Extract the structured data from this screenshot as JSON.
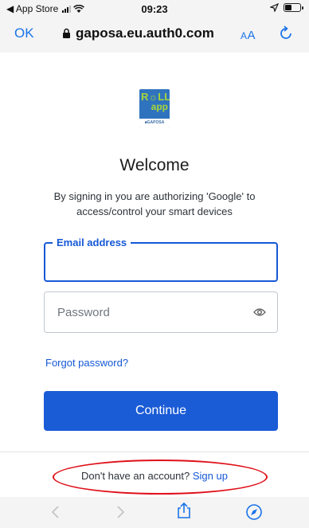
{
  "status_bar": {
    "carrier": "◀ App Store",
    "time": "09:23",
    "battery_level": 0.45
  },
  "address_bar": {
    "done_label": "OK",
    "url": "gaposa.eu.auth0.com",
    "text_size_label_small": "A",
    "text_size_label_large": "A"
  },
  "logo": {
    "line1": "R☼LL",
    "line2": "app",
    "brand": "■GAPOSA"
  },
  "login": {
    "title": "Welcome",
    "subtitle": "By signing in you are authorizing 'Google' to access/control your smart devices",
    "email_label": "Email address",
    "email_value": "",
    "password_placeholder": "Password",
    "forgot_password": "Forgot password?",
    "continue_label": "Continue",
    "no_account_text": "Don't have an account?",
    "signup_label": "Sign up"
  },
  "colors": {
    "accent": "#1a5bd6",
    "annotation": "#e0111b"
  },
  "toolbar": {
    "icons": [
      "back-icon",
      "forward-icon",
      "share-icon",
      "compass-icon"
    ]
  }
}
